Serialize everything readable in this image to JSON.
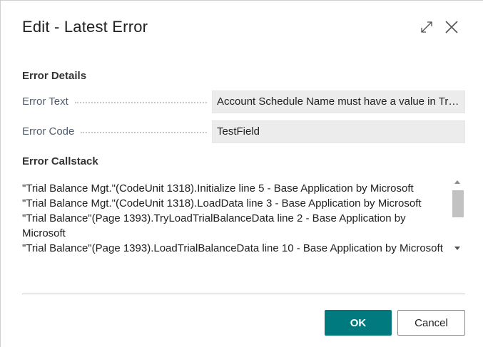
{
  "dialog": {
    "title": "Edit - Latest Error",
    "expand_icon": "expand-icon",
    "close_icon": "close-icon"
  },
  "error_details": {
    "section_title": "Error Details",
    "fields": [
      {
        "label": "Error Text",
        "value": "Account Schedule Name must have a value in Trial Balance Setup: Primary Key=. It cannot be zero or empty."
      },
      {
        "label": "Error Code",
        "value": "TestField"
      }
    ]
  },
  "error_callstack": {
    "section_title": "Error Callstack",
    "lines": [
      "\"Trial Balance Mgt.\"(CodeUnit 1318).Initialize line 5 - Base Application by Microsoft",
      "\"Trial Balance Mgt.\"(CodeUnit 1318).LoadData line 3 - Base Application by Microsoft",
      "\"Trial Balance\"(Page 1393).TryLoadTrialBalanceData line 2 - Base Application by Microsoft",
      "\"Trial Balance\"(Page 1393).LoadTrialBalanceData line 10 - Base Application by Microsoft"
    ]
  },
  "footer": {
    "ok_label": "OK",
    "cancel_label": "Cancel"
  },
  "colors": {
    "primary": "#00797f",
    "field_background": "#ececec",
    "label_text": "#505c6d"
  }
}
